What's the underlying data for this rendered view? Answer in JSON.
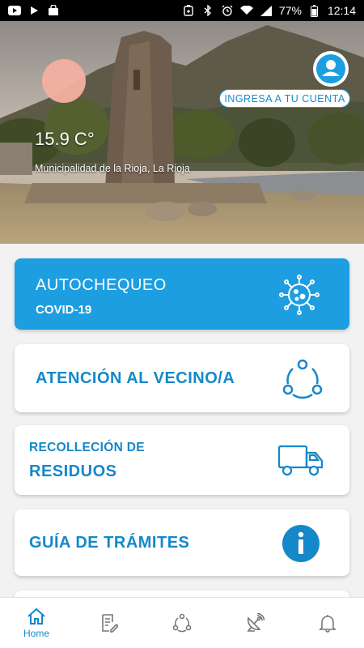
{
  "status_bar": {
    "battery": "77%",
    "time": "12:14",
    "left_icons": [
      "youtube-icon",
      "play-icon",
      "shopping-bag-icon"
    ],
    "right_icons": [
      "battery-saver-icon",
      "bluetooth-icon",
      "alarm-icon",
      "wifi-icon",
      "signal-icon",
      "battery-icon"
    ]
  },
  "hero": {
    "temperature": "15.9 C°",
    "location": "Municipalidad de la Rioja, La Rioja",
    "login_label": "INGRESA A TU CUENTA",
    "sun_color": "#f3b0a0"
  },
  "cards": {
    "covid": {
      "title": "AUTOCHEQUEO",
      "subtitle": "COVID-19",
      "icon": "virus-icon",
      "color": "#1c9ee0"
    },
    "vecino": {
      "title": "ATENCIÓN AL VECINO/A",
      "icon": "share-network-icon"
    },
    "residuos": {
      "line1": "RECOLLECIÓN DE",
      "line2": "RESIDUOS",
      "icon": "truck-icon"
    },
    "tramites": {
      "title": "GUÍA DE TRÁMITES",
      "icon": "info-icon"
    }
  },
  "bottom_nav": {
    "items": [
      {
        "label": "Home",
        "icon": "home-icon",
        "active": true
      },
      {
        "label": "",
        "icon": "document-edit-icon",
        "active": false
      },
      {
        "label": "",
        "icon": "share-network-icon",
        "active": false
      },
      {
        "label": "",
        "icon": "satellite-dish-icon",
        "active": false
      },
      {
        "label": "",
        "icon": "bell-icon",
        "active": false
      }
    ]
  },
  "colors": {
    "accent": "#1c9ee0",
    "text_blue": "#1588c9",
    "background": "#f2f2f2"
  }
}
